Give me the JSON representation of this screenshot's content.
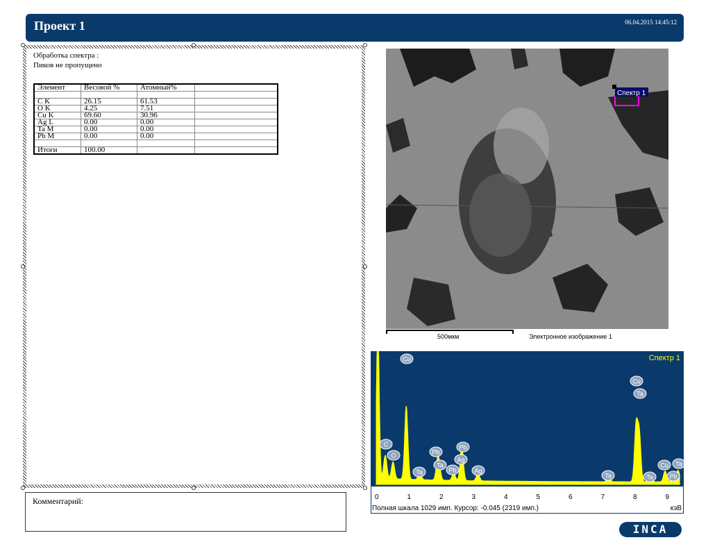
{
  "header": {
    "title": "Проект 1",
    "timestamp": "06.04.2015 14:45:12"
  },
  "report": {
    "line1": "Обработка спектра :",
    "line2": "Пиков не пропущено",
    "table": {
      "headers": [
        "Элемент",
        "Весовой %",
        "Атомный%",
        ""
      ],
      "rows": [
        [
          "",
          "",
          "",
          ""
        ],
        [
          "C K",
          "26.15",
          "61.53",
          ""
        ],
        [
          "O K",
          "4.25",
          "7.51",
          ""
        ],
        [
          "Cu K",
          "69.60",
          "30.96",
          ""
        ],
        [
          "Ag L",
          "0.00",
          "0.00",
          ""
        ],
        [
          "Ta M",
          "0.00",
          "0.00",
          ""
        ],
        [
          "Pb M",
          "0.00",
          "0.00",
          ""
        ],
        [
          "",
          "",
          "",
          ""
        ],
        [
          "Итоги",
          "100.00",
          "",
          ""
        ]
      ]
    }
  },
  "comment": {
    "label": "Комментарий:"
  },
  "image": {
    "spectrum_marker": "Спектр 1",
    "scale_label": "500мкм",
    "caption": "Электронное изображение 1"
  },
  "spectrum": {
    "title": "Спектр 1",
    "ticks": [
      "0",
      "1",
      "2",
      "3",
      "4",
      "5",
      "6",
      "7",
      "8",
      "9"
    ],
    "info": "Полная шкала 1029 имп. Курсор: -0.045  (2319 имп.)",
    "unit": "кэВ",
    "peaks": [
      {
        "label": "Cu",
        "kev": 0.93,
        "h": 0.95
      },
      {
        "label": "C",
        "kev": 0.28,
        "h": 0.3
      },
      {
        "label": "O",
        "kev": 0.52,
        "h": 0.22
      },
      {
        "label": "Pb",
        "kev": 1.9,
        "h": 0.22
      },
      {
        "label": "Ta",
        "kev": 1.95,
        "h": 0.14
      },
      {
        "label": "Pb",
        "kev": 2.4,
        "h": 0.1
      },
      {
        "label": "Pb",
        "kev": 2.65,
        "h": 0.27
      },
      {
        "label": "Ag",
        "kev": 2.65,
        "h": 0.18
      },
      {
        "label": "Ag",
        "kev": 3.15,
        "h": 0.1
      },
      {
        "label": "Ta",
        "kev": 1.35,
        "h": 0.09
      },
      {
        "label": "Cu",
        "kev": 8.05,
        "h": 0.72
      },
      {
        "label": "Ta",
        "kev": 8.15,
        "h": 0.62
      },
      {
        "label": "Ta",
        "kev": 7.2,
        "h": 0.07
      },
      {
        "label": "Ta",
        "kev": 8.5,
        "h": 0.06
      },
      {
        "label": "Cu",
        "kev": 8.95,
        "h": 0.14
      },
      {
        "label": "Pb",
        "kev": 9.2,
        "h": 0.07
      },
      {
        "label": "Ta",
        "kev": 9.35,
        "h": 0.15
      }
    ],
    "colors": {
      "bg": "#0a3a6b",
      "trace": "#ffff00",
      "title": "#ffff00"
    }
  },
  "logo": {
    "text": "INCA"
  }
}
